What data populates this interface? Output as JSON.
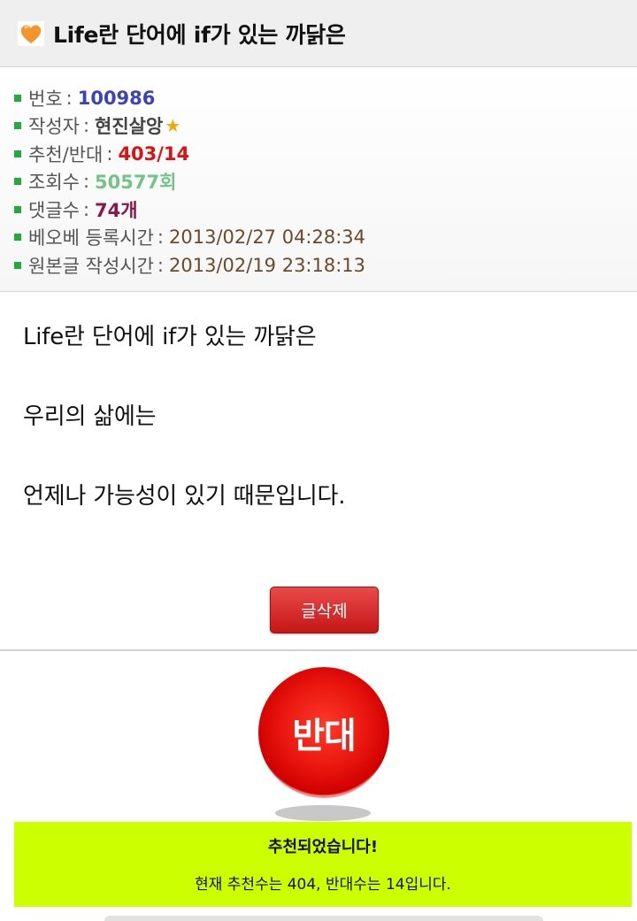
{
  "header": {
    "title": "Life란 단어에 if가 있는 까닭은",
    "icon": "heart-icon"
  },
  "meta": {
    "number": {
      "label": "번호",
      "value": "100986"
    },
    "author": {
      "label": "작성자",
      "value": "현진살앙",
      "badge": "★"
    },
    "votes": {
      "label": "추천/반대",
      "value": "403/14"
    },
    "views": {
      "label": "조회수",
      "value": "50577회"
    },
    "comments": {
      "label": "댓글수",
      "value": "74개"
    },
    "registered": {
      "label": "베오베 등록시간",
      "value": "2013/02/27 04:28:34"
    },
    "written": {
      "label": "원본글 작성시간",
      "value": "2013/02/19 23:18:13"
    }
  },
  "content": {
    "lines": [
      "Life란 단어에 if가 있는 까닭은",
      "우리의 삶에는",
      "언제나 가능성이 있기 때문입니다."
    ]
  },
  "actions": {
    "delete_label": "글삭제",
    "oppose_label": "반대"
  },
  "notice": {
    "title": "추천되었습니다!",
    "message": "현재 추천수는 404, 반대수는 14입니다."
  },
  "colors": {
    "accent_red": "#e01010",
    "notice_bg": "#ccff00",
    "bullet": "#22aa3c"
  }
}
